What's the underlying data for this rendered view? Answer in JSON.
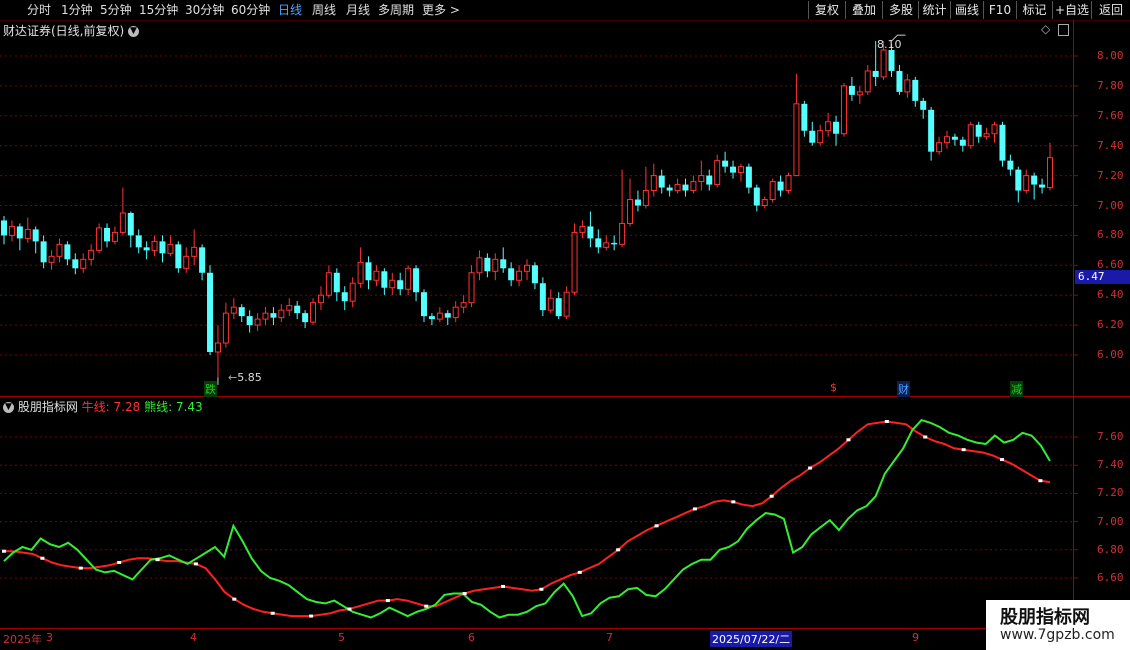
{
  "toolbar": {
    "periods": [
      "分时",
      "1分钟",
      "5分钟",
      "15分钟",
      "30分钟",
      "60分钟",
      "日线",
      "周线",
      "月线",
      "多周期",
      "更多 >"
    ],
    "active_period": "日线",
    "buttons": [
      "复权",
      "叠加",
      "多股",
      "统计",
      "画线",
      "F10",
      "+自选",
      "返回"
    ],
    "mark_button": "标记"
  },
  "main_panel": {
    "title": "财达证券(日线,前复权)",
    "high_label": "8.10",
    "low_label": "5.85",
    "current_price": "6.47",
    "event_tags": [
      {
        "text": "跌",
        "color": "#22cc22"
      },
      {
        "text": "$",
        "color": "#ff3030"
      },
      {
        "text": "财",
        "color": "#4da6ff"
      },
      {
        "text": "减",
        "color": "#22cc22"
      }
    ],
    "y_labels": [
      "8.00",
      "7.80",
      "7.60",
      "7.40",
      "7.20",
      "7.00",
      "6.80",
      "6.60",
      "6.40",
      "6.20",
      "6.00"
    ]
  },
  "indicator_panel": {
    "name": "股朋指标网",
    "bull_label": "牛线: 7.28",
    "bear_label": "熊线: 7.43",
    "y_labels": [
      "7.60",
      "7.40",
      "7.20",
      "7.00",
      "6.80",
      "6.60"
    ]
  },
  "date_axis": [
    "2025年",
    "3",
    "4",
    "5",
    "6",
    "7",
    "2025/07/22/二",
    "9"
  ],
  "watermark": {
    "title": "股朋指标网",
    "url": "www.7gpzb.com"
  },
  "colors": {
    "up": "#ff3232",
    "down": "#54ffff",
    "bull": "#ff2020",
    "bear": "#33ee33",
    "grid": "#800000"
  },
  "chart_data": {
    "type": "candlestick",
    "title": "财达证券(日线,前复权)",
    "ylim": [
      5.8,
      8.15
    ],
    "candles": [
      [
        6.9,
        6.8,
        6.93,
        6.74
      ],
      [
        6.8,
        6.86,
        6.9,
        6.76
      ],
      [
        6.86,
        6.78,
        6.88,
        6.7
      ],
      [
        6.78,
        6.84,
        6.92,
        6.75
      ],
      [
        6.84,
        6.76,
        6.86,
        6.68
      ],
      [
        6.76,
        6.62,
        6.8,
        6.58
      ],
      [
        6.62,
        6.66,
        6.7,
        6.57
      ],
      [
        6.66,
        6.74,
        6.78,
        6.62
      ],
      [
        6.74,
        6.64,
        6.76,
        6.6
      ],
      [
        6.64,
        6.58,
        6.68,
        6.54
      ],
      [
        6.58,
        6.64,
        6.68,
        6.55
      ],
      [
        6.64,
        6.7,
        6.74,
        6.6
      ],
      [
        6.7,
        6.85,
        6.88,
        6.68
      ],
      [
        6.85,
        6.76,
        6.88,
        6.72
      ],
      [
        6.76,
        6.82,
        6.86,
        6.74
      ],
      [
        6.82,
        6.95,
        7.12,
        6.8
      ],
      [
        6.95,
        6.8,
        6.96,
        6.72
      ],
      [
        6.8,
        6.72,
        6.84,
        6.68
      ],
      [
        6.72,
        6.7,
        6.76,
        6.64
      ],
      [
        6.7,
        6.76,
        6.8,
        6.66
      ],
      [
        6.76,
        6.68,
        6.8,
        6.62
      ],
      [
        6.68,
        6.74,
        6.8,
        6.66
      ],
      [
        6.74,
        6.58,
        6.76,
        6.55
      ],
      [
        6.58,
        6.66,
        6.72,
        6.55
      ],
      [
        6.66,
        6.72,
        6.84,
        6.6
      ],
      [
        6.72,
        6.55,
        6.74,
        6.5
      ],
      [
        6.55,
        6.02,
        6.6,
        6.0
      ],
      [
        6.02,
        6.08,
        6.2,
        5.85
      ],
      [
        6.08,
        6.28,
        6.35,
        6.05
      ],
      [
        6.28,
        6.32,
        6.38,
        6.24
      ],
      [
        6.32,
        6.26,
        6.34,
        6.22
      ],
      [
        6.26,
        6.2,
        6.3,
        6.15
      ],
      [
        6.2,
        6.24,
        6.28,
        6.16
      ],
      [
        6.24,
        6.28,
        6.32,
        6.2
      ],
      [
        6.28,
        6.25,
        6.32,
        6.2
      ],
      [
        6.25,
        6.3,
        6.34,
        6.22
      ],
      [
        6.3,
        6.33,
        6.38,
        6.26
      ],
      [
        6.33,
        6.28,
        6.36,
        6.24
      ],
      [
        6.28,
        6.22,
        6.3,
        6.18
      ],
      [
        6.22,
        6.35,
        6.38,
        6.2
      ],
      [
        6.35,
        6.4,
        6.46,
        6.3
      ],
      [
        6.4,
        6.55,
        6.6,
        6.38
      ],
      [
        6.55,
        6.42,
        6.58,
        6.36
      ],
      [
        6.42,
        6.36,
        6.46,
        6.3
      ],
      [
        6.36,
        6.48,
        6.52,
        6.32
      ],
      [
        6.48,
        6.62,
        6.72,
        6.45
      ],
      [
        6.62,
        6.5,
        6.66,
        6.44
      ],
      [
        6.5,
        6.56,
        6.6,
        6.46
      ],
      [
        6.56,
        6.45,
        6.58,
        6.4
      ],
      [
        6.45,
        6.5,
        6.55,
        6.4
      ],
      [
        6.5,
        6.44,
        6.55,
        6.4
      ],
      [
        6.44,
        6.58,
        6.6,
        6.4
      ],
      [
        6.58,
        6.42,
        6.6,
        6.36
      ],
      [
        6.42,
        6.26,
        6.44,
        6.22
      ],
      [
        6.26,
        6.24,
        6.28,
        6.2
      ],
      [
        6.24,
        6.28,
        6.32,
        6.22
      ],
      [
        6.28,
        6.25,
        6.3,
        6.2
      ],
      [
        6.25,
        6.32,
        6.36,
        6.22
      ],
      [
        6.32,
        6.35,
        6.4,
        6.28
      ],
      [
        6.35,
        6.55,
        6.6,
        6.32
      ],
      [
        6.55,
        6.65,
        6.7,
        6.5
      ],
      [
        6.65,
        6.56,
        6.68,
        6.52
      ],
      [
        6.56,
        6.64,
        6.68,
        6.5
      ],
      [
        6.64,
        6.58,
        6.72,
        6.55
      ],
      [
        6.58,
        6.5,
        6.62,
        6.46
      ],
      [
        6.5,
        6.56,
        6.6,
        6.46
      ],
      [
        6.56,
        6.6,
        6.64,
        6.5
      ],
      [
        6.6,
        6.48,
        6.62,
        6.44
      ],
      [
        6.48,
        6.3,
        6.52,
        6.26
      ],
      [
        6.3,
        6.38,
        6.44,
        6.28
      ],
      [
        6.38,
        6.26,
        6.42,
        6.24
      ],
      [
        6.26,
        6.42,
        6.46,
        6.24
      ],
      [
        6.42,
        6.82,
        6.88,
        6.4
      ],
      [
        6.82,
        6.86,
        6.9,
        6.78
      ],
      [
        6.86,
        6.78,
        6.96,
        6.72
      ],
      [
        6.78,
        6.72,
        6.84,
        6.68
      ],
      [
        6.72,
        6.75,
        6.8,
        6.7
      ],
      [
        6.75,
        6.74,
        6.8,
        6.7
      ],
      [
        6.74,
        6.88,
        7.24,
        6.72
      ],
      [
        6.88,
        7.04,
        7.18,
        6.86
      ],
      [
        7.04,
        7.0,
        7.1,
        6.96
      ],
      [
        7.0,
        7.1,
        7.26,
        6.98
      ],
      [
        7.1,
        7.2,
        7.28,
        7.06
      ],
      [
        7.2,
        7.12,
        7.24,
        7.08
      ],
      [
        7.12,
        7.1,
        7.14,
        7.06
      ],
      [
        7.1,
        7.14,
        7.18,
        7.08
      ],
      [
        7.14,
        7.1,
        7.18,
        7.06
      ],
      [
        7.1,
        7.16,
        7.2,
        7.08
      ],
      [
        7.16,
        7.2,
        7.3,
        7.1
      ],
      [
        7.2,
        7.14,
        7.24,
        7.1
      ],
      [
        7.14,
        7.3,
        7.34,
        7.12
      ],
      [
        7.3,
        7.26,
        7.36,
        7.22
      ],
      [
        7.26,
        7.22,
        7.3,
        7.18
      ],
      [
        7.22,
        7.26,
        7.28,
        7.16
      ],
      [
        7.26,
        7.12,
        7.28,
        7.08
      ],
      [
        7.12,
        7.0,
        7.14,
        6.96
      ],
      [
        7.0,
        7.04,
        7.06,
        6.98
      ],
      [
        7.04,
        7.16,
        7.18,
        7.02
      ],
      [
        7.16,
        7.1,
        7.2,
        7.06
      ],
      [
        7.1,
        7.2,
        7.22,
        7.08
      ],
      [
        7.2,
        7.68,
        7.88,
        7.2
      ],
      [
        7.68,
        7.5,
        7.7,
        7.46
      ],
      [
        7.5,
        7.42,
        7.56,
        7.4
      ],
      [
        7.42,
        7.5,
        7.54,
        7.4
      ],
      [
        7.5,
        7.56,
        7.62,
        7.46
      ],
      [
        7.56,
        7.48,
        7.6,
        7.4
      ],
      [
        7.48,
        7.8,
        7.82,
        7.46
      ],
      [
        7.8,
        7.74,
        7.86,
        7.7
      ],
      [
        7.74,
        7.76,
        7.8,
        7.68
      ],
      [
        7.76,
        7.9,
        7.94,
        7.74
      ],
      [
        7.9,
        7.86,
        8.1,
        7.8
      ],
      [
        7.86,
        8.04,
        8.1,
        7.84
      ],
      [
        8.04,
        7.9,
        8.08,
        7.86
      ],
      [
        7.9,
        7.76,
        7.94,
        7.74
      ],
      [
        7.76,
        7.84,
        7.88,
        7.72
      ],
      [
        7.84,
        7.7,
        7.86,
        7.66
      ],
      [
        7.7,
        7.64,
        7.72,
        7.58
      ],
      [
        7.64,
        7.36,
        7.66,
        7.3
      ],
      [
        7.36,
        7.42,
        7.46,
        7.34
      ],
      [
        7.42,
        7.46,
        7.5,
        7.38
      ],
      [
        7.46,
        7.44,
        7.48,
        7.4
      ],
      [
        7.44,
        7.4,
        7.46,
        7.36
      ],
      [
        7.4,
        7.54,
        7.56,
        7.38
      ],
      [
        7.54,
        7.46,
        7.56,
        7.42
      ],
      [
        7.46,
        7.48,
        7.52,
        7.44
      ],
      [
        7.48,
        7.54,
        7.56,
        7.42
      ],
      [
        7.54,
        7.3,
        7.56,
        7.26
      ],
      [
        7.3,
        7.24,
        7.34,
        7.2
      ],
      [
        7.24,
        7.1,
        7.26,
        7.02
      ],
      [
        7.1,
        7.2,
        7.24,
        7.08
      ],
      [
        7.2,
        7.14,
        7.22,
        7.04
      ],
      [
        7.14,
        7.12,
        7.18,
        7.08
      ],
      [
        7.12,
        7.32,
        7.42,
        7.1
      ]
    ],
    "bull_line": [
      6.79,
      6.79,
      6.78,
      6.77,
      6.74,
      6.71,
      6.69,
      6.68,
      6.67,
      6.67,
      6.68,
      6.69,
      6.71,
      6.73,
      6.74,
      6.74,
      6.73,
      6.72,
      6.72,
      6.71,
      6.7,
      6.67,
      6.59,
      6.5,
      6.45,
      6.41,
      6.38,
      6.36,
      6.35,
      6.34,
      6.33,
      6.33,
      6.33,
      6.34,
      6.35,
      6.37,
      6.38,
      6.4,
      6.42,
      6.44,
      6.44,
      6.45,
      6.44,
      6.42,
      6.4,
      6.4,
      6.43,
      6.46,
      6.49,
      6.51,
      6.52,
      6.53,
      6.54,
      6.53,
      6.52,
      6.51,
      6.52,
      6.56,
      6.59,
      6.62,
      6.64,
      6.67,
      6.7,
      6.75,
      6.8,
      6.86,
      6.9,
      6.94,
      6.97,
      7.0,
      7.03,
      7.06,
      7.09,
      7.11,
      7.14,
      7.15,
      7.14,
      7.12,
      7.11,
      7.13,
      7.18,
      7.24,
      7.29,
      7.33,
      7.38,
      7.42,
      7.47,
      7.52,
      7.58,
      7.64,
      7.69,
      7.7,
      7.71,
      7.7,
      7.69,
      7.64,
      7.6,
      7.57,
      7.55,
      7.52,
      7.51,
      7.5,
      7.49,
      7.47,
      7.44,
      7.41,
      7.37,
      7.33,
      7.29,
      7.28
    ],
    "bear_line": [
      6.72,
      6.78,
      6.82,
      6.8,
      6.88,
      6.84,
      6.82,
      6.85,
      6.8,
      6.73,
      6.66,
      6.64,
      6.65,
      6.62,
      6.59,
      6.66,
      6.73,
      6.74,
      6.76,
      6.73,
      6.7,
      6.74,
      6.78,
      6.82,
      6.75,
      6.97,
      6.86,
      6.74,
      6.65,
      6.6,
      6.58,
      6.55,
      6.5,
      6.45,
      6.43,
      6.42,
      6.44,
      6.4,
      6.36,
      6.34,
      6.32,
      6.35,
      6.39,
      6.36,
      6.33,
      6.36,
      6.38,
      6.41,
      6.48,
      6.49,
      6.49,
      6.43,
      6.41,
      6.36,
      6.32,
      6.34,
      6.34,
      6.36,
      6.4,
      6.42,
      6.5,
      6.56,
      6.47,
      6.33,
      6.35,
      6.42,
      6.46,
      6.47,
      6.52,
      6.53,
      6.48,
      6.47,
      6.52,
      6.59,
      6.66,
      6.7,
      6.73,
      6.73,
      6.8,
      6.82,
      6.86,
      6.95,
      7.01,
      7.06,
      7.05,
      7.02,
      6.78,
      6.82,
      6.91,
      6.96,
      7.01,
      6.94,
      7.02,
      7.08,
      7.11,
      7.18,
      7.34,
      7.43,
      7.52,
      7.65,
      7.72,
      7.7,
      7.67,
      7.63,
      7.61,
      7.58,
      7.56,
      7.55,
      7.61,
      7.56,
      7.58,
      7.63,
      7.61,
      7.54,
      7.43
    ]
  }
}
